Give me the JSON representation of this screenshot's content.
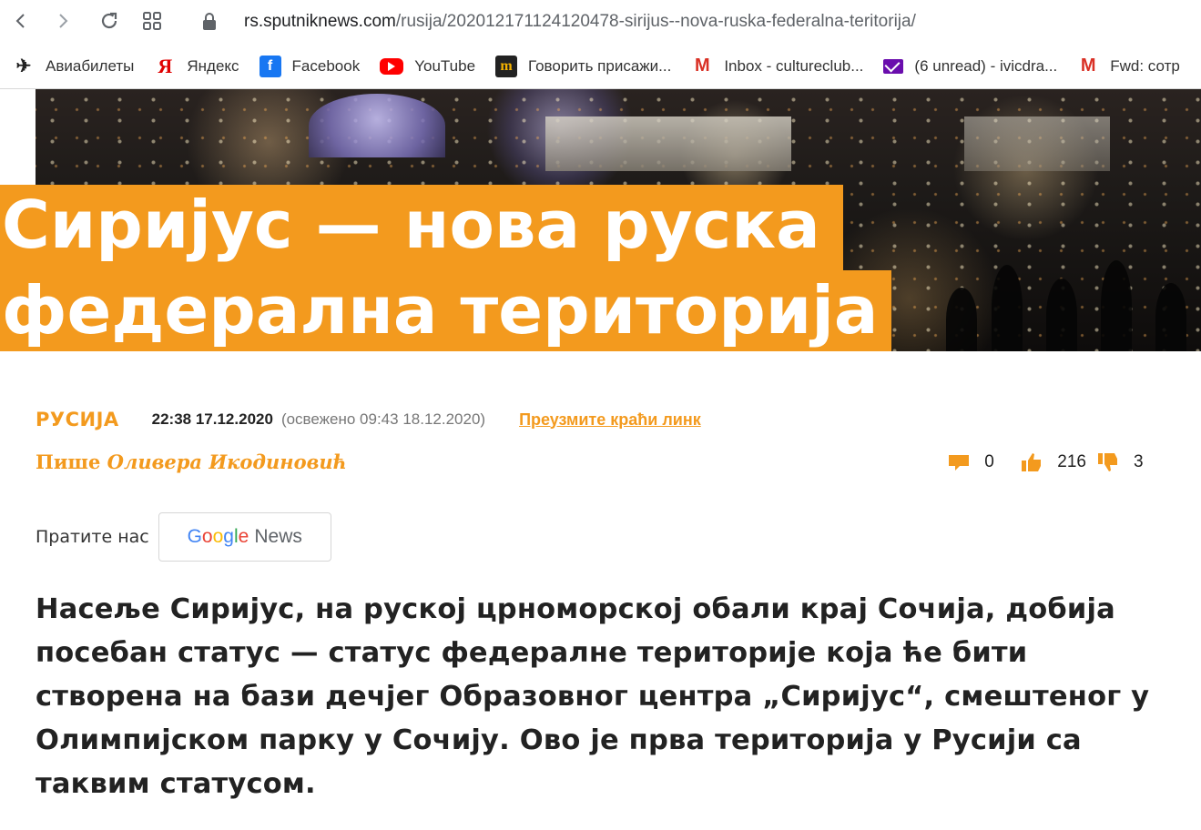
{
  "browser": {
    "url_host": "rs.sputniknews.com",
    "url_path": "/rusija/202012171124120478-sirijus--nova-ruska-federalna-teritorija/",
    "bookmarks": [
      {
        "label": "Авиабилеты",
        "icon": "airplane-icon"
      },
      {
        "label": "Яндекс",
        "icon": "yandex-icon"
      },
      {
        "label": "Facebook",
        "icon": "facebook-icon"
      },
      {
        "label": "YouTube",
        "icon": "youtube-icon"
      },
      {
        "label": "Говорить присажи...",
        "icon": "m-icon"
      },
      {
        "label": "Inbox - cultureclub...",
        "icon": "gmail-icon"
      },
      {
        "label": "(6 unread) - ivicdra...",
        "icon": "mail-icon"
      },
      {
        "label": "Fwd: сотр",
        "icon": "gmail-icon"
      }
    ]
  },
  "article": {
    "title_line1": "Сиријус — нова руска",
    "title_line2": "федерална територија",
    "category": "РУСИЈА",
    "published": "22:38 17.12.2020",
    "updated": "(освежено 09:43 18.12.2020)",
    "short_link": "Преузмите краћи линк",
    "author_prefix": "Пише",
    "author_name": "Оливера Икодиновић",
    "comments_count": "0",
    "likes_count": "216",
    "dislikes_count": "3",
    "follow_label": "Пратите нас",
    "google_news": {
      "g1": "G",
      "g2": "o",
      "g3": "o",
      "g4": "g",
      "g5": "l",
      "g6": "e",
      "news": "News"
    },
    "lead": "Насеље Сиријус, на руској црноморској обали крај Сочија, добија посебан статус — статус федералне територије која ће бити створена на бази дечјег Образовног центра „Сиријус“, смештеног у Олимпијском парку у Сочију. Ово је прва територија у Русији са таквим статусом."
  },
  "colors": {
    "accent": "#f39a1e",
    "text": "#222222",
    "muted": "#777777"
  }
}
